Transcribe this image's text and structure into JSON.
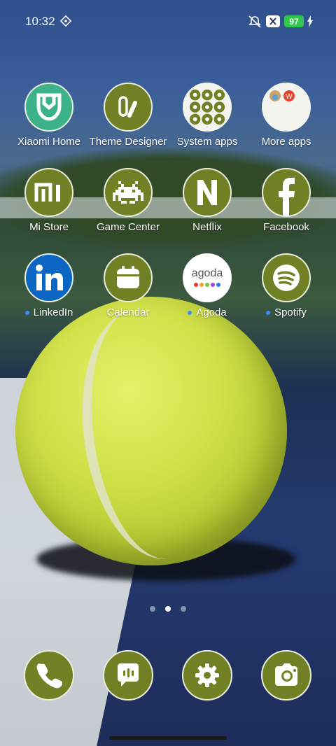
{
  "status_bar": {
    "time": "10:32",
    "battery_level": "97",
    "battery_color": "#2fc84d",
    "icons": [
      "location-diamond-icon",
      "silent-bell-icon",
      "x-badge-icon",
      "charging-bolt-icon"
    ]
  },
  "apps": [
    {
      "label": "Xiaomi Home",
      "icon": "xiaomi-home-icon",
      "badge": false
    },
    {
      "label": "Theme Designer",
      "icon": "theme-designer-icon",
      "badge": false
    },
    {
      "label": "System apps",
      "icon": "system-apps-folder-icon",
      "badge": false
    },
    {
      "label": "More apps",
      "icon": "more-apps-folder-icon",
      "badge": false
    },
    {
      "label": "Mi Store",
      "icon": "mi-store-icon",
      "badge": false
    },
    {
      "label": "Game Center",
      "icon": "game-center-icon",
      "badge": false
    },
    {
      "label": "Netflix",
      "icon": "netflix-icon",
      "badge": false
    },
    {
      "label": "Facebook",
      "icon": "facebook-icon",
      "badge": false
    },
    {
      "label": "LinkedIn",
      "icon": "linkedin-icon",
      "badge": true
    },
    {
      "label": "Calendar",
      "icon": "calendar-icon",
      "badge": false
    },
    {
      "label": "Agoda",
      "icon": "agoda-icon",
      "badge": true,
      "icon_text": "agoda"
    },
    {
      "label": "Spotify",
      "icon": "spotify-icon",
      "badge": true
    }
  ],
  "pager": {
    "pages": 3,
    "active": 2
  },
  "dock": [
    {
      "icon": "phone-icon"
    },
    {
      "icon": "messages-icon"
    },
    {
      "icon": "settings-gear-icon"
    },
    {
      "icon": "camera-icon"
    }
  ],
  "colors": {
    "olive_tile": "#717f25",
    "badge_dot": "#3d8bff",
    "xiaomi_green": "#3bb28a",
    "linkedin_blue": "#0a66c2"
  }
}
